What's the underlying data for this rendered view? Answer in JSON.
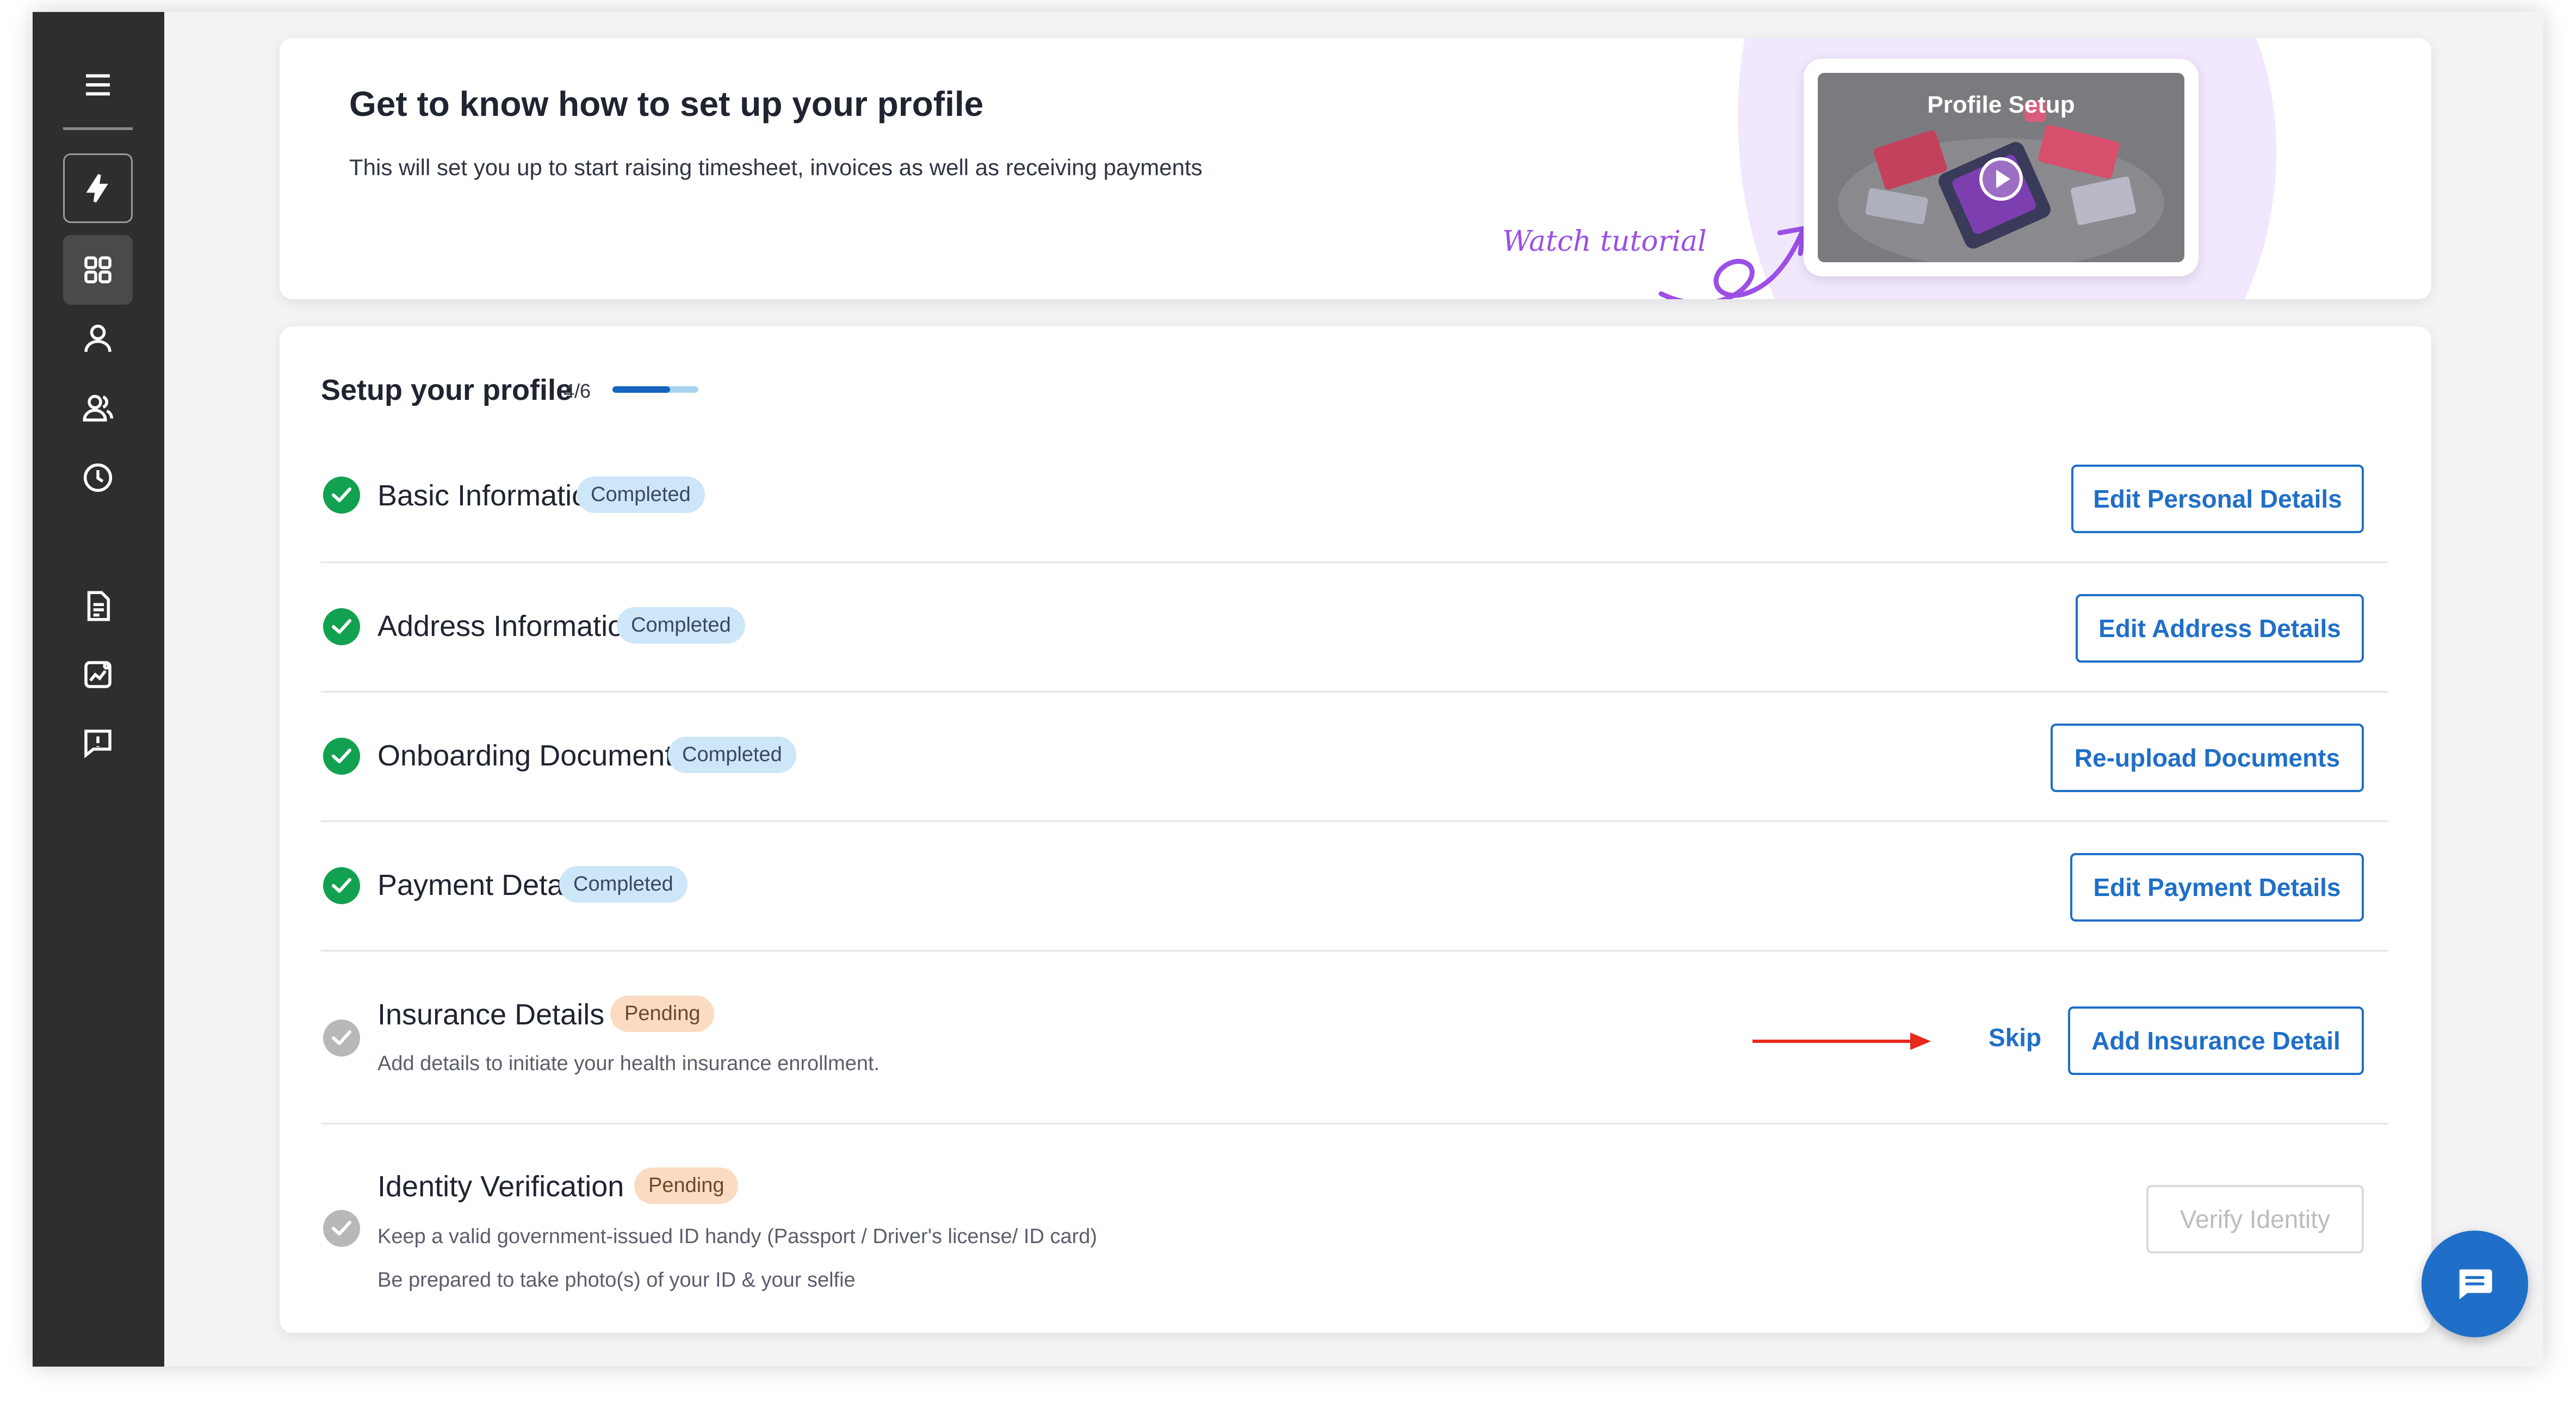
{
  "sidebar": {
    "icons": [
      "menu-icon",
      "lightning-icon",
      "dashboard-grid-icon",
      "user-icon",
      "users-icon",
      "clock-icon",
      "document-icon",
      "chart-icon",
      "feedback-icon"
    ]
  },
  "hero": {
    "title": "Get to know how to set up your profile",
    "subtitle": "This will set you up to start raising timesheet, invoices as well as receiving payments",
    "watch_label": "Watch tutorial",
    "video_title": "Profile Setup"
  },
  "setup": {
    "title": "Setup your profile",
    "progress_text": "4/6",
    "progress_fraction": 0.67,
    "rows": [
      {
        "label": "Basic Information",
        "status": "Completed",
        "action": "Edit Personal Details"
      },
      {
        "label": "Address Information",
        "status": "Completed",
        "action": "Edit Address Details"
      },
      {
        "label": "Onboarding Documents",
        "status": "Completed",
        "action": "Re-upload Documents"
      },
      {
        "label": "Payment Details",
        "status": "Completed",
        "action": "Edit Payment Details"
      },
      {
        "label": "Insurance Details",
        "status": "Pending",
        "description": "Add details to initiate your health insurance enrollment.",
        "skip_label": "Skip",
        "action": "Add Insurance Detail"
      },
      {
        "label": "Identity Verification",
        "status": "Pending",
        "description": "Keep a valid government-issued ID handy (Passport / Driver's license/ ID card)",
        "description2": "Be prepared to take photo(s) of your ID & your selfie",
        "action": "Verify Identity"
      }
    ]
  },
  "colors": {
    "accent": "#1f6fc8",
    "completed": "#12a150",
    "pending_check": "#b8b8b8",
    "sidebar": "#2e2e2e",
    "tutorial": "#9b4fe6"
  }
}
